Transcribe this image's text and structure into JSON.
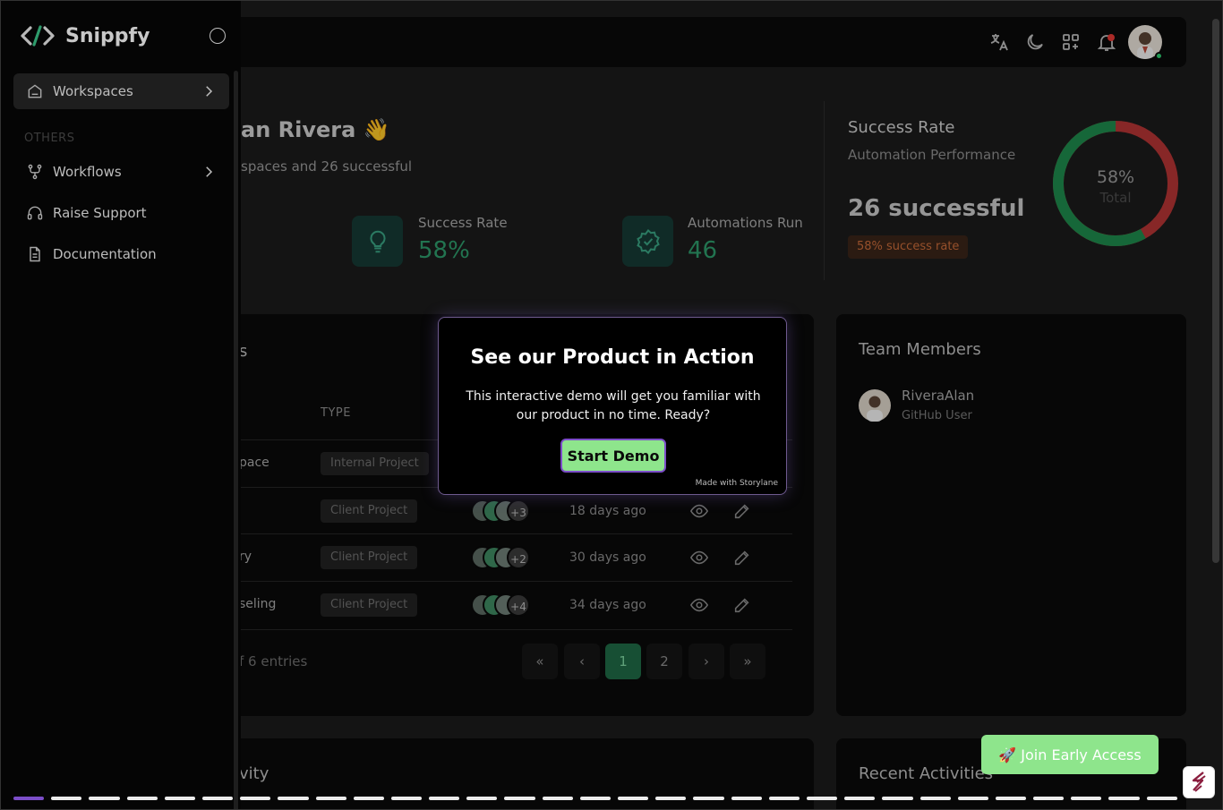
{
  "app": {
    "name": "Snippfy"
  },
  "sidebar": {
    "section_label": "OTHERS",
    "items": [
      {
        "label": "Workspaces",
        "icon": "home-icon",
        "active": true,
        "has_children": true
      },
      {
        "label": "Workflows",
        "icon": "workflow-icon",
        "active": false,
        "has_children": true
      },
      {
        "label": "Raise Support",
        "icon": "headphones-icon",
        "active": false,
        "has_children": false
      },
      {
        "label": "Documentation",
        "icon": "document-icon",
        "active": false,
        "has_children": false
      }
    ]
  },
  "header": {
    "icons": [
      "translate-icon",
      "moon-icon",
      "apps-grid-icon",
      "bell-icon"
    ],
    "notification_dot_color": "#e53935"
  },
  "welcome": {
    "title_visible": "an Rivera 👋",
    "subtitle_visible": "spaces and 26 successful",
    "stats": [
      {
        "label": "Success Rate",
        "value": "58%",
        "icon": "bulb-icon"
      },
      {
        "label": "Automations Run",
        "value": "46",
        "icon": "verified-badge-icon"
      }
    ]
  },
  "success_card": {
    "title": "Success Rate",
    "subtitle": "Automation Performance",
    "big": "26 successful",
    "badge": "58% success rate",
    "donut": {
      "percent": 58,
      "label_pct": "58%",
      "label_total": "Total",
      "success_color": "#1e8a4c",
      "fail_color": "#b53434"
    }
  },
  "workspaces_table": {
    "title_visible": "s",
    "column_type": "TYPE",
    "rows": [
      {
        "name": "pace",
        "type": "Internal Project",
        "more": "",
        "date": ""
      },
      {
        "name": "",
        "type": "Client Project",
        "more": "+3",
        "date": "18 days ago"
      },
      {
        "name": "ry",
        "type": "Client Project",
        "more": "+2",
        "date": "30 days ago"
      },
      {
        "name": "seling",
        "type": "Client Project",
        "more": "+4",
        "date": "34 days ago"
      }
    ],
    "entries_visible": "f 6 entries",
    "pagination": {
      "first": "«",
      "prev": "‹",
      "pages": [
        "1",
        "2"
      ],
      "active": "1",
      "next": "›",
      "last": "»"
    }
  },
  "team": {
    "title": "Team Members",
    "members": [
      {
        "name": "RiveraAlan",
        "role": "GitHub User"
      }
    ]
  },
  "activity_card": {
    "title_visible": "vity"
  },
  "recent": {
    "title": "Recent Activities"
  },
  "modal": {
    "title": "See our Product in Action",
    "body": "This interactive demo will get you familiar with our product in no time. Ready?",
    "button": "Start Demo",
    "credit": "Made with Storylane"
  },
  "join_button": {
    "label": "🚀  Join Early Access"
  },
  "demo_progress": {
    "steps": 31,
    "completed": 1
  }
}
